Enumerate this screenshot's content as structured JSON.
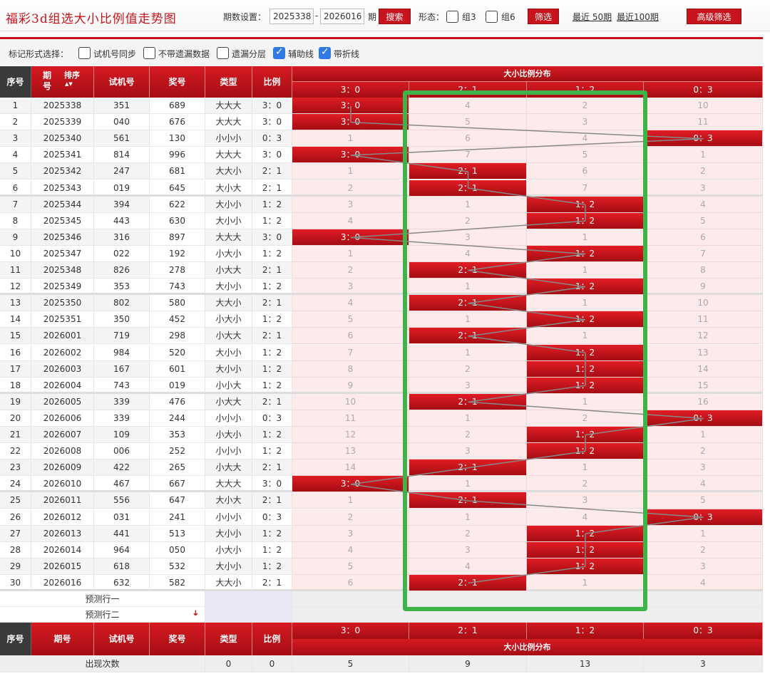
{
  "header": {
    "title": "福彩3d组选大小比例值走势图",
    "period_label": "期数设置：",
    "period_from": "2025338",
    "period_dash": "-",
    "period_to": "2026016",
    "period_unit": "期",
    "search_label": "搜索",
    "form_label": "形态：",
    "group3_label": "组3",
    "group6_label": "组6",
    "filter_label": "筛选",
    "recent50_label": "最近 50期",
    "recent100_label": "最近100期",
    "advanced_label": "高级筛选"
  },
  "options": {
    "label": "标记形式选择：",
    "items": [
      {
        "label": "试机号同步",
        "checked": false
      },
      {
        "label": "不带遗漏数据",
        "checked": false
      },
      {
        "label": "遗漏分层",
        "checked": false
      },
      {
        "label": "辅助线",
        "checked": true
      },
      {
        "label": "带折线",
        "checked": true
      }
    ]
  },
  "table": {
    "headers": {
      "idx": "序号",
      "period": "期号",
      "sort": "排序",
      "trial": "试机号",
      "prize": "奖号",
      "type": "类型",
      "ratio": "比例",
      "dist": "大小比例分布"
    },
    "dist_columns": [
      "3：0",
      "2：1",
      "1：2",
      "0：3"
    ],
    "rows": [
      {
        "idx": "1",
        "period": "2025338",
        "trial": "351",
        "prize": "689",
        "type": "大大大",
        "ratio": "3：0",
        "dist": [
          "3：0",
          "4",
          "2",
          "10"
        ],
        "hit": 0
      },
      {
        "idx": "2",
        "period": "2025339",
        "trial": "040",
        "prize": "676",
        "type": "大大大",
        "ratio": "3：0",
        "dist": [
          "3：0",
          "5",
          "3",
          "11"
        ],
        "hit": 0
      },
      {
        "idx": "3",
        "period": "2025340",
        "trial": "561",
        "prize": "130",
        "type": "小小小",
        "ratio": "0：3",
        "dist": [
          "1",
          "6",
          "4",
          "0：3"
        ],
        "hit": 3
      },
      {
        "idx": "4",
        "period": "2025341",
        "trial": "814",
        "prize": "996",
        "type": "大大大",
        "ratio": "3：0",
        "dist": [
          "3：0",
          "7",
          "5",
          "1"
        ],
        "hit": 0
      },
      {
        "idx": "5",
        "period": "2025342",
        "trial": "247",
        "prize": "681",
        "type": "大大小",
        "ratio": "2：1",
        "dist": [
          "1",
          "2：1",
          "6",
          "2"
        ],
        "hit": 1
      },
      {
        "idx": "6",
        "period": "2025343",
        "trial": "019",
        "prize": "645",
        "type": "大小大",
        "ratio": "2：1",
        "dist": [
          "2",
          "2：1",
          "7",
          "3"
        ],
        "hit": 1
      },
      {
        "idx": "7",
        "period": "2025344",
        "trial": "394",
        "prize": "622",
        "type": "大小小",
        "ratio": "1：2",
        "dist": [
          "3",
          "1",
          "1：2",
          "4"
        ],
        "hit": 2
      },
      {
        "idx": "8",
        "period": "2025345",
        "trial": "443",
        "prize": "630",
        "type": "大小小",
        "ratio": "1：2",
        "dist": [
          "4",
          "2",
          "1：2",
          "5"
        ],
        "hit": 2
      },
      {
        "idx": "9",
        "period": "2025346",
        "trial": "316",
        "prize": "897",
        "type": "大大大",
        "ratio": "3：0",
        "dist": [
          "3：0",
          "3",
          "1",
          "6"
        ],
        "hit": 0
      },
      {
        "idx": "10",
        "period": "2025347",
        "trial": "022",
        "prize": "192",
        "type": "小大小",
        "ratio": "1：2",
        "dist": [
          "1",
          "4",
          "1：2",
          "7"
        ],
        "hit": 2
      },
      {
        "idx": "11",
        "period": "2025348",
        "trial": "826",
        "prize": "278",
        "type": "小大大",
        "ratio": "2：1",
        "dist": [
          "2",
          "2：1",
          "1",
          "8"
        ],
        "hit": 1
      },
      {
        "idx": "12",
        "period": "2025349",
        "trial": "353",
        "prize": "743",
        "type": "大小小",
        "ratio": "1：2",
        "dist": [
          "3",
          "1",
          "1：2",
          "9"
        ],
        "hit": 2
      },
      {
        "idx": "13",
        "period": "2025350",
        "trial": "802",
        "prize": "580",
        "type": "大大小",
        "ratio": "2：1",
        "dist": [
          "4",
          "2：1",
          "1",
          "10"
        ],
        "hit": 1
      },
      {
        "idx": "14",
        "period": "2025351",
        "trial": "350",
        "prize": "452",
        "type": "小大小",
        "ratio": "1：2",
        "dist": [
          "5",
          "1",
          "1：2",
          "11"
        ],
        "hit": 2
      },
      {
        "idx": "15",
        "period": "2026001",
        "trial": "719",
        "prize": "298",
        "type": "小大大",
        "ratio": "2：1",
        "dist": [
          "6",
          "2：1",
          "1",
          "12"
        ],
        "hit": 1
      },
      {
        "idx": "16",
        "period": "2026002",
        "trial": "984",
        "prize": "520",
        "type": "大小小",
        "ratio": "1：2",
        "dist": [
          "7",
          "1",
          "1：2",
          "13"
        ],
        "hit": 2
      },
      {
        "idx": "17",
        "period": "2026003",
        "trial": "167",
        "prize": "601",
        "type": "大小小",
        "ratio": "1：2",
        "dist": [
          "8",
          "2",
          "1：2",
          "14"
        ],
        "hit": 2
      },
      {
        "idx": "18",
        "period": "2026004",
        "trial": "743",
        "prize": "019",
        "type": "小小大",
        "ratio": "1：2",
        "dist": [
          "9",
          "3",
          "1：2",
          "15"
        ],
        "hit": 2
      },
      {
        "idx": "19",
        "period": "2026005",
        "trial": "339",
        "prize": "476",
        "type": "小大大",
        "ratio": "2：1",
        "dist": [
          "10",
          "2：1",
          "1",
          "16"
        ],
        "hit": 1
      },
      {
        "idx": "20",
        "period": "2026006",
        "trial": "339",
        "prize": "244",
        "type": "小小小",
        "ratio": "0：3",
        "dist": [
          "11",
          "1",
          "2",
          "0：3"
        ],
        "hit": 3
      },
      {
        "idx": "21",
        "period": "2026007",
        "trial": "109",
        "prize": "353",
        "type": "小大小",
        "ratio": "1：2",
        "dist": [
          "12",
          "2",
          "1：2",
          "1"
        ],
        "hit": 2
      },
      {
        "idx": "22",
        "period": "2026008",
        "trial": "006",
        "prize": "252",
        "type": "小小小",
        "ratio": "1：2",
        "dist": [
          "13",
          "3",
          "1：2",
          "2"
        ],
        "hit": 2
      },
      {
        "idx": "23",
        "period": "2026009",
        "trial": "422",
        "prize": "265",
        "type": "小大大",
        "ratio": "2：1",
        "dist": [
          "14",
          "2：1",
          "1",
          "3"
        ],
        "hit": 1
      },
      {
        "idx": "24",
        "period": "2026010",
        "trial": "467",
        "prize": "667",
        "type": "大大大",
        "ratio": "3：0",
        "dist": [
          "3：0",
          "1",
          "2",
          "4"
        ],
        "hit": 0
      },
      {
        "idx": "25",
        "period": "2026011",
        "trial": "556",
        "prize": "647",
        "type": "大小大",
        "ratio": "2：1",
        "dist": [
          "1",
          "2：1",
          "3",
          "5"
        ],
        "hit": 1
      },
      {
        "idx": "26",
        "period": "2026012",
        "trial": "031",
        "prize": "241",
        "type": "小小小",
        "ratio": "0：3",
        "dist": [
          "2",
          "1",
          "4",
          "0：3"
        ],
        "hit": 3
      },
      {
        "idx": "27",
        "period": "2026013",
        "trial": "441",
        "prize": "513",
        "type": "大小小",
        "ratio": "1：2",
        "dist": [
          "3",
          "2",
          "1：2",
          "1"
        ],
        "hit": 2
      },
      {
        "idx": "28",
        "period": "2026014",
        "trial": "964",
        "prize": "050",
        "type": "小大小",
        "ratio": "1：2",
        "dist": [
          "4",
          "3",
          "1：2",
          "2"
        ],
        "hit": 2
      },
      {
        "idx": "29",
        "period": "2026015",
        "trial": "618",
        "prize": "532",
        "type": "大小小",
        "ratio": "1：2",
        "dist": [
          "5",
          "4",
          "1：2",
          "3"
        ],
        "hit": 2
      },
      {
        "idx": "30",
        "period": "2026016",
        "trial": "632",
        "prize": "582",
        "type": "大大小",
        "ratio": "2：1",
        "dist": [
          "6",
          "2：1",
          "1",
          "4"
        ],
        "hit": 1
      }
    ],
    "predict_rows": [
      "预测行一",
      "预测行二"
    ],
    "footer_headers": {
      "idx": "序号",
      "period": "期号",
      "trial": "试机号",
      "prize": "奖号",
      "type": "类型",
      "ratio": "比例",
      "dist": "大小比例分布"
    },
    "stats": {
      "label": "出现次数",
      "type": "0",
      "ratio": "0",
      "dist": [
        "5",
        "9",
        "13",
        "3"
      ]
    }
  },
  "colors": {
    "brand_red": "#c8141c",
    "highlight_green": "#3db34a",
    "check_blue": "#2f7ae5"
  }
}
